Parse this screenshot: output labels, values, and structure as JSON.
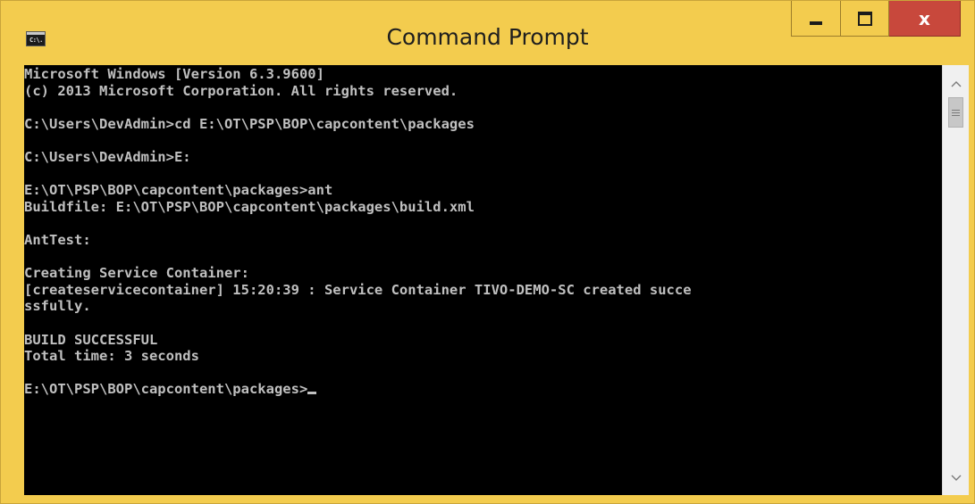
{
  "window": {
    "title": "Command Prompt",
    "icon": "console-app-icon",
    "icon_text": "C:\\.",
    "frame_color": "#f3cc4e",
    "close_color": "#c8483c",
    "buttons": {
      "minimize": "minimize-icon",
      "maximize": "maximize-icon",
      "close_glyph": "x"
    }
  },
  "console": {
    "background": "#000000",
    "text_color": "#c0c0c0",
    "lines": [
      "Microsoft Windows [Version 6.3.9600]",
      "(c) 2013 Microsoft Corporation. All rights reserved.",
      "",
      "C:\\Users\\DevAdmin>cd E:\\OT\\PSP\\BOP\\capcontent\\packages",
      "",
      "C:\\Users\\DevAdmin>E:",
      "",
      "E:\\OT\\PSP\\BOP\\capcontent\\packages>ant",
      "Buildfile: E:\\OT\\PSP\\BOP\\capcontent\\packages\\build.xml",
      "",
      "AntTest:",
      "",
      "Creating Service Container:",
      "[createservicecontainer] 15:20:39 : Service Container TIVO-DEMO-SC created succe",
      "ssfully.",
      "",
      "BUILD SUCCESSFUL",
      "Total time: 3 seconds",
      "",
      "E:\\OT\\PSP\\BOP\\capcontent\\packages>"
    ]
  },
  "scrollbar": {
    "up_icon": "scroll-up-arrow-icon",
    "down_icon": "scroll-down-arrow-icon"
  }
}
